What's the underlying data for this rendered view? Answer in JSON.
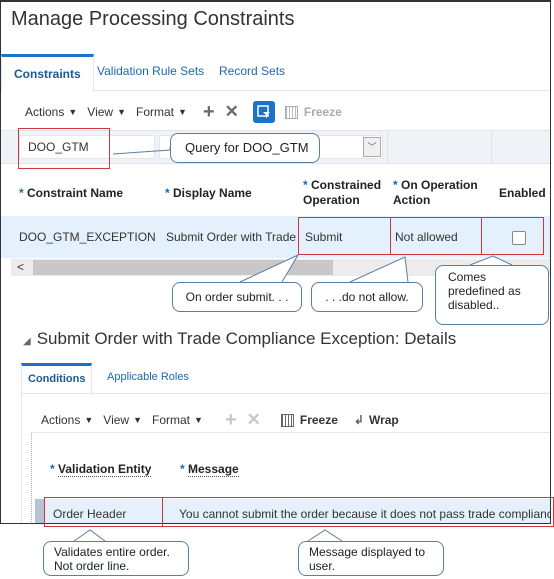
{
  "page": {
    "title": "Manage Processing Constraints"
  },
  "tabs": [
    {
      "label": "Constraints",
      "active": true
    },
    {
      "label": "Validation Rule Sets",
      "active": false
    },
    {
      "label": "Record Sets",
      "active": false
    }
  ],
  "toolbar": {
    "actions": "Actions",
    "view": "View",
    "format": "Format",
    "add_icon": "plus-icon",
    "delete_icon": "x-icon",
    "qbe_icon": "query-by-example-icon",
    "freeze": "Freeze"
  },
  "filter": {
    "constraint_name_value": "DOO_GTM"
  },
  "table": {
    "columns": [
      {
        "label": "Constraint Name",
        "required": true
      },
      {
        "label": "Display Name",
        "required": true
      },
      {
        "label": "Constrained Operation",
        "line1": "Constrained",
        "line2": "Operation",
        "required": true
      },
      {
        "label": "On Operation Action",
        "line1": "On Operation",
        "line2": "Action",
        "required": true
      },
      {
        "label": "Enabled",
        "required": false
      }
    ],
    "rows": [
      {
        "constraint_name": "DOO_GTM_EXCEPTION",
        "display_name": "Submit Order with Trade",
        "constrained_operation": "Submit",
        "on_operation_action": "Not allowed",
        "enabled": false
      }
    ]
  },
  "details": {
    "title": "Submit Order with Trade Compliance Exception: Details",
    "tabs": [
      {
        "label": "Conditions",
        "active": true
      },
      {
        "label": "Applicable Roles",
        "active": false
      }
    ],
    "toolbar": {
      "actions": "Actions",
      "view": "View",
      "format": "Format",
      "freeze": "Freeze",
      "wrap": "Wrap"
    },
    "columns": [
      {
        "label": "Validation Entity",
        "required": true
      },
      {
        "label": "Message",
        "required": true
      }
    ],
    "rows": [
      {
        "validation_entity": "Order Header",
        "message": "You cannot submit the order because it does not pass trade compliance"
      }
    ]
  },
  "callouts": {
    "query": "Query for DOO_GTM",
    "on_submit": "On order  submit. . .",
    "do_not_allow": ". . .do not allow.",
    "predefined": "Comes predefined  as disabled..",
    "validates": "Validates entire order. Not order line.",
    "message": "Message displayed to user."
  },
  "colors": {
    "accent": "#1a73c9",
    "highlight_border": "#d0383e",
    "selected_row": "#e4f0fb",
    "callout_border": "#5b7ea4"
  }
}
